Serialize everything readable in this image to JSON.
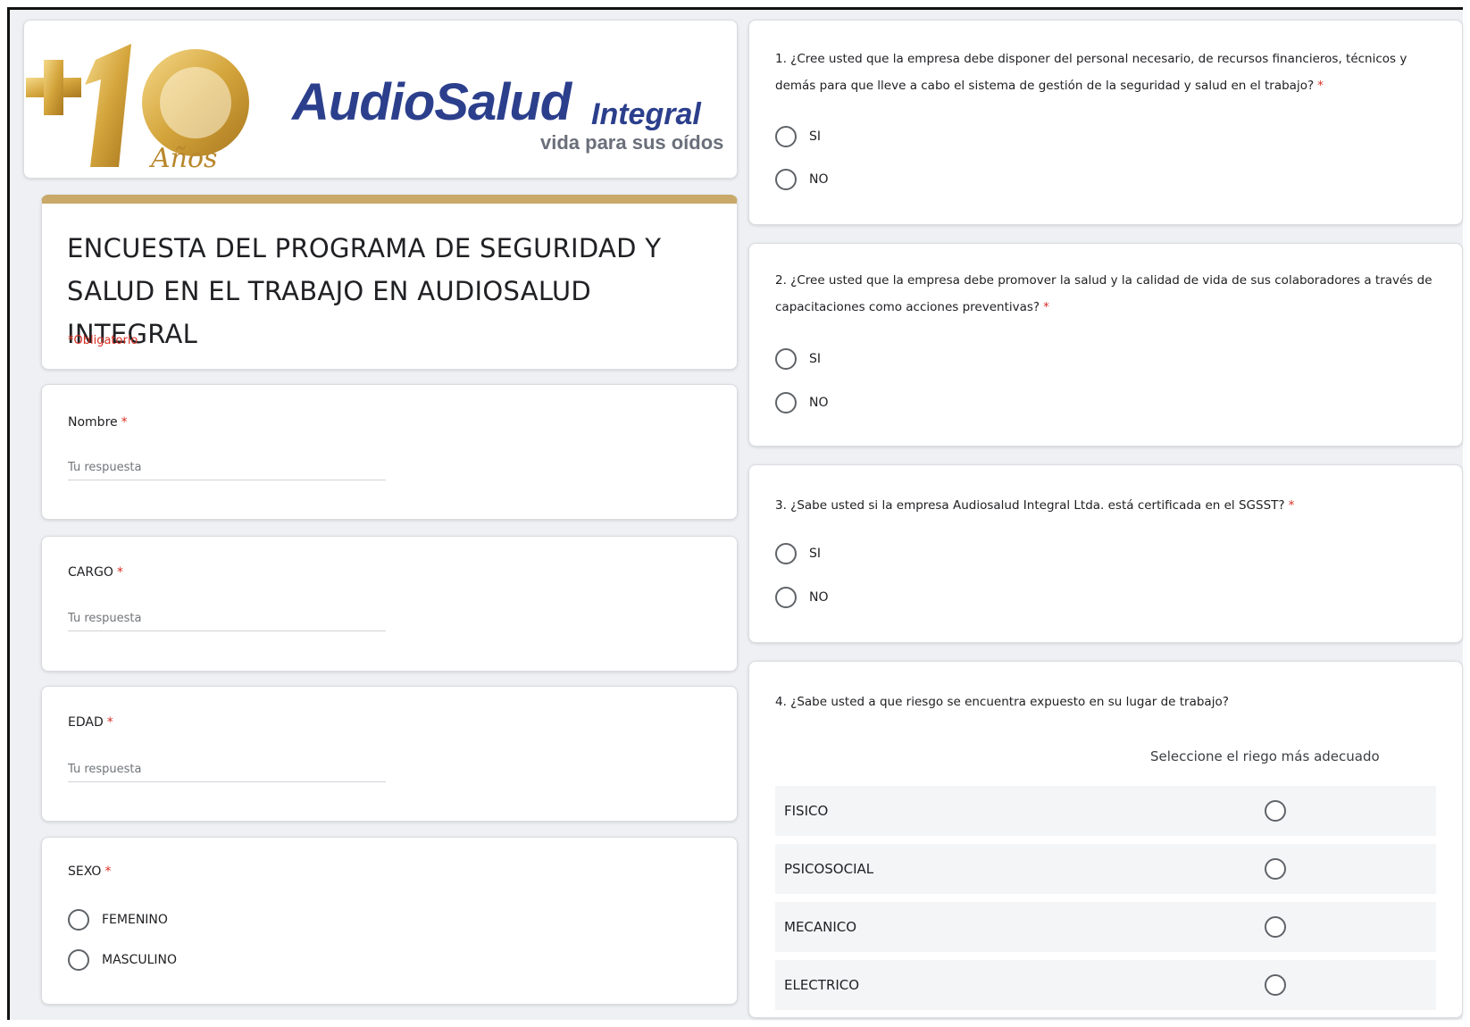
{
  "brand": {
    "badge_text": "+10 Años",
    "name_main": "AudioSalud",
    "name_sub": "Integral",
    "tagline": "vida para sus oídos"
  },
  "form": {
    "title": "ENCUESTA DEL PROGRAMA DE SEGURIDAD Y SALUD EN EL TRABAJO EN AUDIOSALUD INTEGRAL",
    "required_note": "*Obligatorio",
    "accent_color": "#c9a969",
    "required_color": "#d93025"
  },
  "fields": {
    "nombre": {
      "label": "Nombre",
      "placeholder": "Tu respuesta",
      "required_mark": "*"
    },
    "cargo": {
      "label": "CARGO",
      "placeholder": "Tu respuesta",
      "required_mark": "*"
    },
    "edad": {
      "label": "EDAD",
      "placeholder": "Tu respuesta",
      "required_mark": "*"
    },
    "sexo": {
      "label": "SEXO",
      "required_mark": "*",
      "options": [
        "FEMENINO",
        "MASCULINO"
      ]
    }
  },
  "questions": [
    {
      "text": "1. ¿Cree usted que la empresa debe disponer del personal necesario, de recursos financieros, técnicos y demás para que lleve a cabo el sistema de gestión de la seguridad y salud en el trabajo?",
      "required_mark": "*",
      "options": [
        "SI",
        "NO"
      ]
    },
    {
      "text": "2. ¿Cree usted que la empresa debe promover la salud y la calidad de vida de sus colaboradores a través de capacitaciones como acciones preventivas?",
      "required_mark": "*",
      "options": [
        "SI",
        "NO"
      ]
    },
    {
      "text": "3. ¿Sabe usted si la empresa Audiosalud Integral Ltda. está certificada en el SGSST?",
      "required_mark": "*",
      "options": [
        "SI",
        "NO"
      ]
    },
    {
      "text": "4. ¿Sabe usted a que riesgo se encuentra expuesto en su lugar de trabajo?",
      "column_header": "Seleccione el riego más adecuado",
      "rows": [
        "FISICO",
        "PSICOSOCIAL",
        "MECANICO",
        "ELECTRICO"
      ]
    }
  ]
}
